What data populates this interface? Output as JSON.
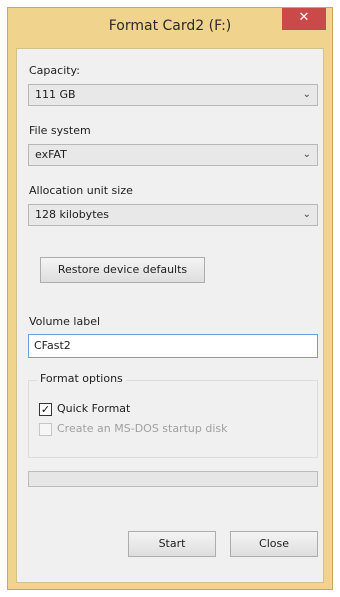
{
  "window": {
    "title": "Format Card2 (F:)",
    "close_glyph": "✕"
  },
  "capacity": {
    "label": "Capacity:",
    "value": "111 GB"
  },
  "file_system": {
    "label": "File system",
    "value": "exFAT"
  },
  "allocation": {
    "label": "Allocation unit size",
    "value": "128 kilobytes"
  },
  "restore_button": "Restore device defaults",
  "volume": {
    "label": "Volume label",
    "value": "CFast2"
  },
  "format_options": {
    "title": "Format options",
    "quick_format": {
      "label": "Quick Format",
      "checked": true
    },
    "msdos": {
      "label": "Create an MS-DOS startup disk",
      "checked": false,
      "enabled": false
    }
  },
  "progress": {
    "fraction": 0
  },
  "buttons": {
    "start": "Start",
    "close": "Close"
  },
  "icons": {
    "chevron": "chevron-down-icon",
    "check": "check-icon"
  },
  "colors": {
    "frame": "#f0d38c",
    "close": "#c94a48",
    "client": "#f0f0f0"
  }
}
